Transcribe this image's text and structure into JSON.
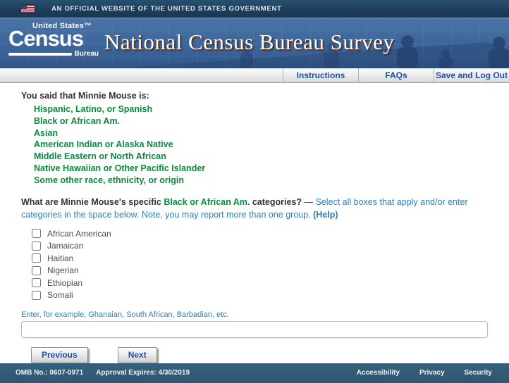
{
  "banner": {
    "text": "AN OFFICIAL WEBSITE OF THE UNITED STATES GOVERNMENT"
  },
  "header": {
    "logo": {
      "top": "United States™",
      "main": "Census",
      "sub": "Bureau"
    },
    "title": "National Census Bureau Survey"
  },
  "nav": {
    "items": [
      "Instructions",
      "FAQs",
      "Save and Log Out"
    ]
  },
  "main": {
    "intro_heading": "You said that Minnie Mouse is:",
    "selected_categories": [
      "Hispanic, Latino, or Spanish",
      "Black or African Am.",
      "Asian",
      "American Indian or Alaska Native",
      "Middle Eastern or North African",
      "Native Hawaiian or Other Pacific Islander",
      "Some other race, ethnicity, or origin"
    ],
    "question": {
      "prefix": "What are Minnie Mouse's specific ",
      "highlight": "Black or African Am.",
      "suffix": " categories?",
      "dash": " — ",
      "instructions": "Select all boxes that apply and/or enter categories in the space below. Note, you may report more than one group. ",
      "help_link": "(Help)"
    },
    "checkboxes": [
      {
        "label": "African American",
        "checked": false
      },
      {
        "label": "Jamaican",
        "checked": false
      },
      {
        "label": "Haitian",
        "checked": false
      },
      {
        "label": "Nigerian",
        "checked": false
      },
      {
        "label": "Ethiopian",
        "checked": false
      },
      {
        "label": "Somali",
        "checked": false
      }
    ],
    "input_hint": "Enter, for example, Ghanaian, South African, Barbadian, etc.",
    "input_value": "",
    "buttons": {
      "previous": "Previous",
      "next": "Next"
    }
  },
  "footer": {
    "omb": "OMB No.: 0607-0971",
    "approval": "Approval Expires: 4/30/2019",
    "links": [
      "Accessibility",
      "Privacy",
      "Security"
    ]
  },
  "colors": {
    "banner_navy": "#1d3d5a",
    "header_blue": "#3e689c",
    "title_shadow": "#6e2c0e",
    "nav_link_blue": "#1d4f9e",
    "category_green": "#0a8a3e",
    "instruction_blue": "#2f7db8",
    "footer_steel_blue": "#2e5671"
  }
}
